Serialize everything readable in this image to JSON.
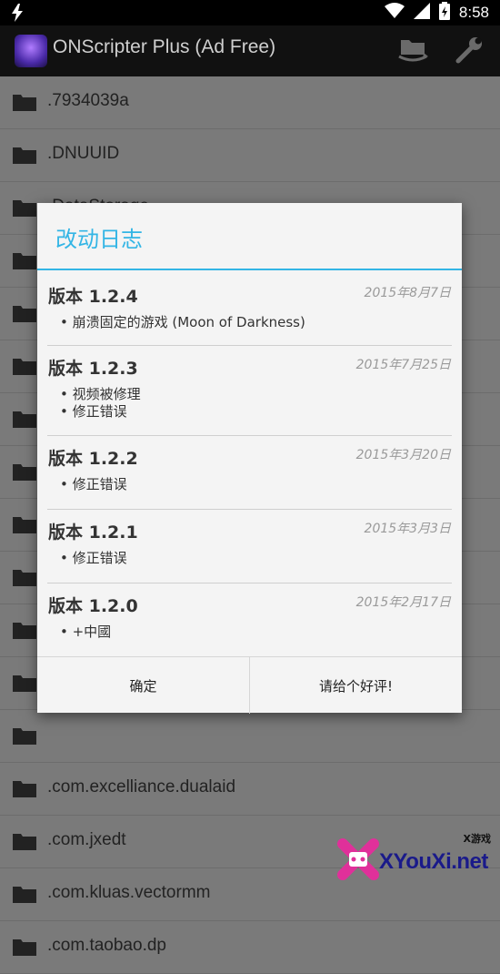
{
  "status_bar": {
    "time": "8:58",
    "icons": [
      "lightning-icon",
      "wifi-icon",
      "signal-icon",
      "battery-icon"
    ]
  },
  "app_bar": {
    "title": "ONScripter Plus (Ad Free)",
    "actions": [
      "folder-sync-icon",
      "wrench-icon"
    ]
  },
  "file_list": [
    ".7934039a",
    ".DNUUID",
    ".DataStorage",
    "",
    "",
    "",
    "",
    "",
    "",
    "",
    "",
    "",
    "",
    ".com.excelliance.dualaid",
    ".com.jxedt",
    ".com.kluas.vectormm",
    ".com.taobao.dp"
  ],
  "dialog": {
    "title": "改动日志",
    "entries": [
      {
        "version": "版本 1.2.4",
        "date": "2015年8月7日",
        "items": [
          "• 崩溃固定的游戏 (Moon of Darkness)"
        ]
      },
      {
        "version": "版本 1.2.3",
        "date": "2015年7月25日",
        "items": [
          "• 视频被修理",
          "• 修正错误"
        ]
      },
      {
        "version": "版本 1.2.2",
        "date": "2015年3月20日",
        "items": [
          "• 修正错误"
        ]
      },
      {
        "version": "版本 1.2.1",
        "date": "2015年3月3日",
        "items": [
          "• 修正错误"
        ]
      },
      {
        "version": "版本 1.2.0",
        "date": "2015年2月17日",
        "items": [
          "• +中國"
        ]
      }
    ],
    "buttons": {
      "ok": "确定",
      "rate": "请给个好评!"
    }
  },
  "watermark": {
    "text": "XYouXi.net",
    "small": "X游戏"
  },
  "colors": {
    "accent": "#33b5e5",
    "appbar": "#111111",
    "list_bg": "#7a7a7a",
    "dialog_bg": "#f4f4f4"
  }
}
